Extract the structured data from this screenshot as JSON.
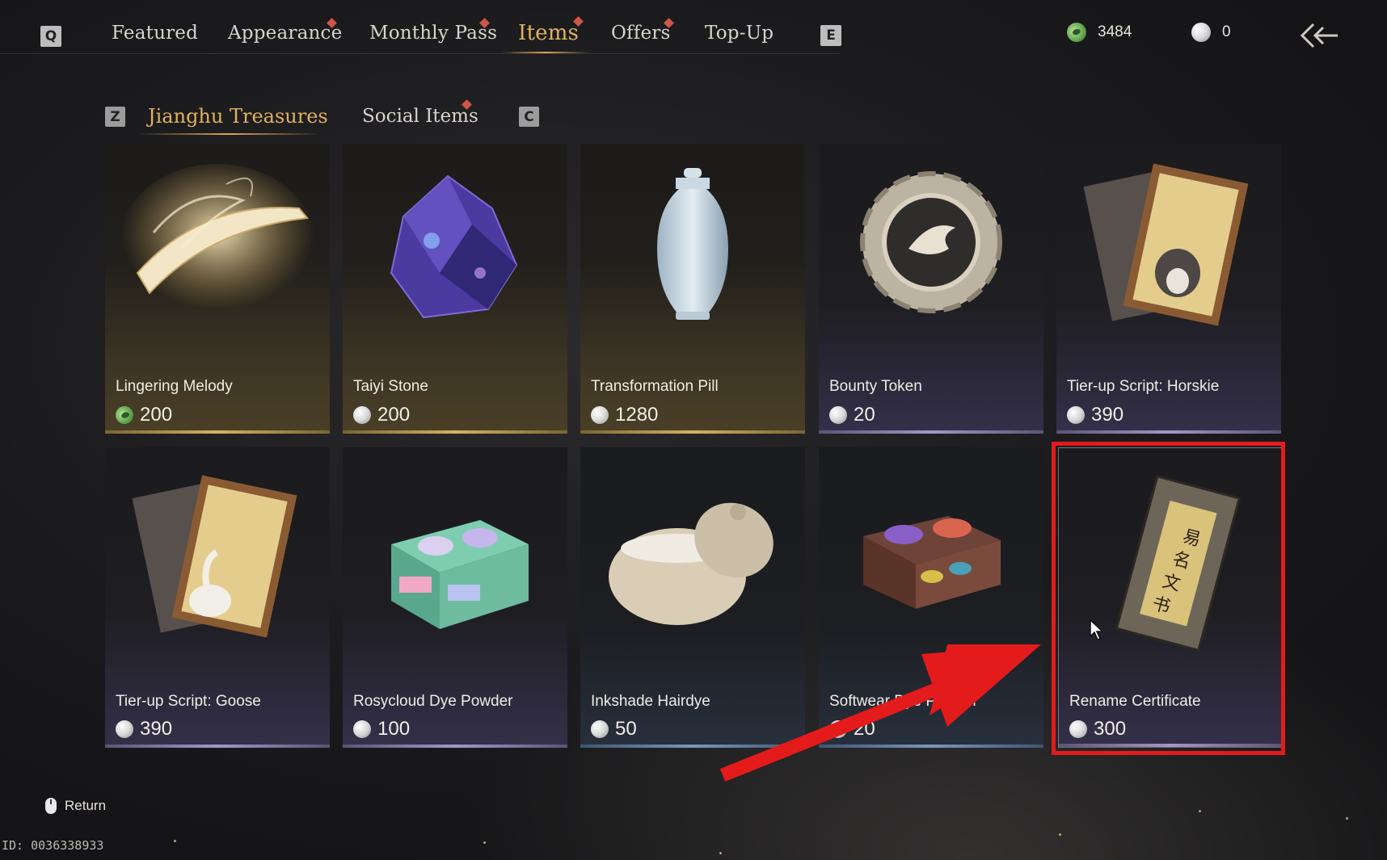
{
  "top_nav": {
    "prev_key": "Q",
    "next_key": "E",
    "tabs": [
      {
        "label": "Featured",
        "badge": false
      },
      {
        "label": "Appearance",
        "badge": true
      },
      {
        "label": "Monthly Pass",
        "badge": true
      },
      {
        "label": "Items",
        "badge": true,
        "active": true
      },
      {
        "label": "Offers",
        "badge": true
      },
      {
        "label": "Top-Up",
        "badge": false
      }
    ]
  },
  "currency": {
    "jade": "3484",
    "pearl": "0"
  },
  "sub_nav": {
    "prev_key": "Z",
    "next_key": "C",
    "tabs": [
      {
        "label": "Jianghu Treasures",
        "active": true
      },
      {
        "label": "Social Items",
        "badge": true
      }
    ]
  },
  "items": [
    {
      "name": "Lingering Melody",
      "price": "200",
      "currency_icon": "jade-icon",
      "rarity": "gold"
    },
    {
      "name": "Taiyi Stone",
      "price": "200",
      "currency_icon": "pearl-icon",
      "rarity": "gold"
    },
    {
      "name": "Transformation Pill",
      "price": "1280",
      "currency_icon": "pearl-icon",
      "rarity": "gold"
    },
    {
      "name": "Bounty Token",
      "price": "20",
      "currency_icon": "pearl-icon",
      "rarity": "purple"
    },
    {
      "name": "Tier-up Script: Horskie",
      "price": "390",
      "currency_icon": "pearl-icon",
      "rarity": "purple"
    },
    {
      "name": "Tier-up Script: Goose",
      "price": "390",
      "currency_icon": "pearl-icon",
      "rarity": "purple"
    },
    {
      "name": "Rosycloud Dye Powder",
      "price": "100",
      "currency_icon": "pearl-icon",
      "rarity": "purple"
    },
    {
      "name": "Inkshade Hairdye",
      "price": "50",
      "currency_icon": "pearl-icon",
      "rarity": "blue"
    },
    {
      "name": "Softwear Dye Powder",
      "price": "20",
      "currency_icon": "pearl-icon",
      "rarity": "blue"
    },
    {
      "name": "Rename Certificate",
      "price": "300",
      "currency_icon": "pearl-icon",
      "rarity": "purple",
      "highlighted": true
    }
  ],
  "footer": {
    "return_label": "Return",
    "player_id": "ID: 0036338933"
  },
  "colors": {
    "accent_gold": "#e0b15c",
    "badge_red": "#d0564a",
    "highlight_red": "#e31b1b"
  }
}
